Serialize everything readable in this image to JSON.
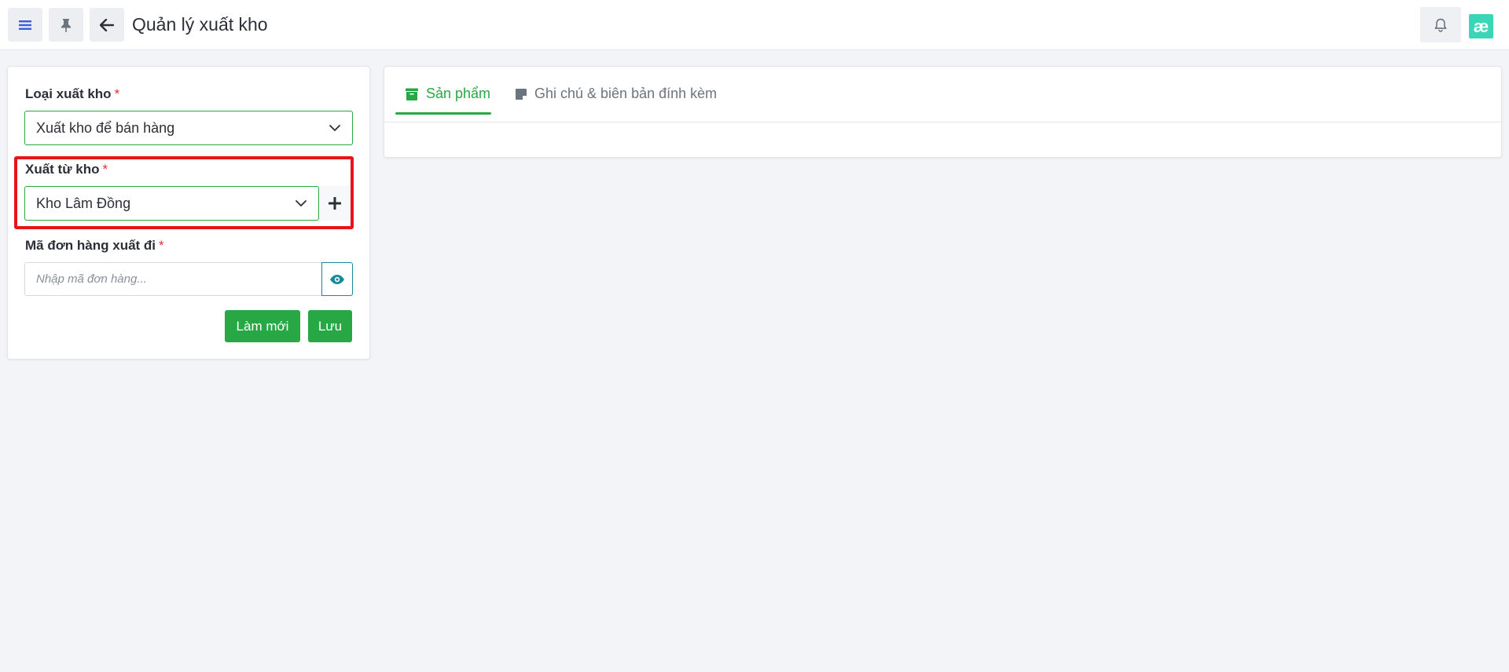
{
  "header": {
    "title": "Quản lý xuất kho",
    "avatar_text": "æ"
  },
  "form": {
    "export_type": {
      "label": "Loại xuất kho",
      "required_mark": "*",
      "value": "Xuất kho để bán hàng"
    },
    "warehouse": {
      "label": "Xuất từ kho",
      "required_mark": "*",
      "value": "Kho Lâm Đồng"
    },
    "order_code": {
      "label": "Mã đơn hàng xuất đi",
      "required_mark": "*",
      "placeholder": "Nhập mã đơn hàng..."
    },
    "buttons": {
      "reset": "Làm mới",
      "save": "Lưu"
    }
  },
  "tabs": [
    {
      "label": "Sản phẩm",
      "icon": "box-icon",
      "active": true
    },
    {
      "label": "Ghi chú & biên bản đính kèm",
      "icon": "sticky-note-icon",
      "active": false
    }
  ],
  "colors": {
    "accent_green": "#27a844",
    "highlight_red": "#e8141b",
    "menu_blue": "#3b5bdb",
    "avatar_teal": "#3ad6b8"
  }
}
